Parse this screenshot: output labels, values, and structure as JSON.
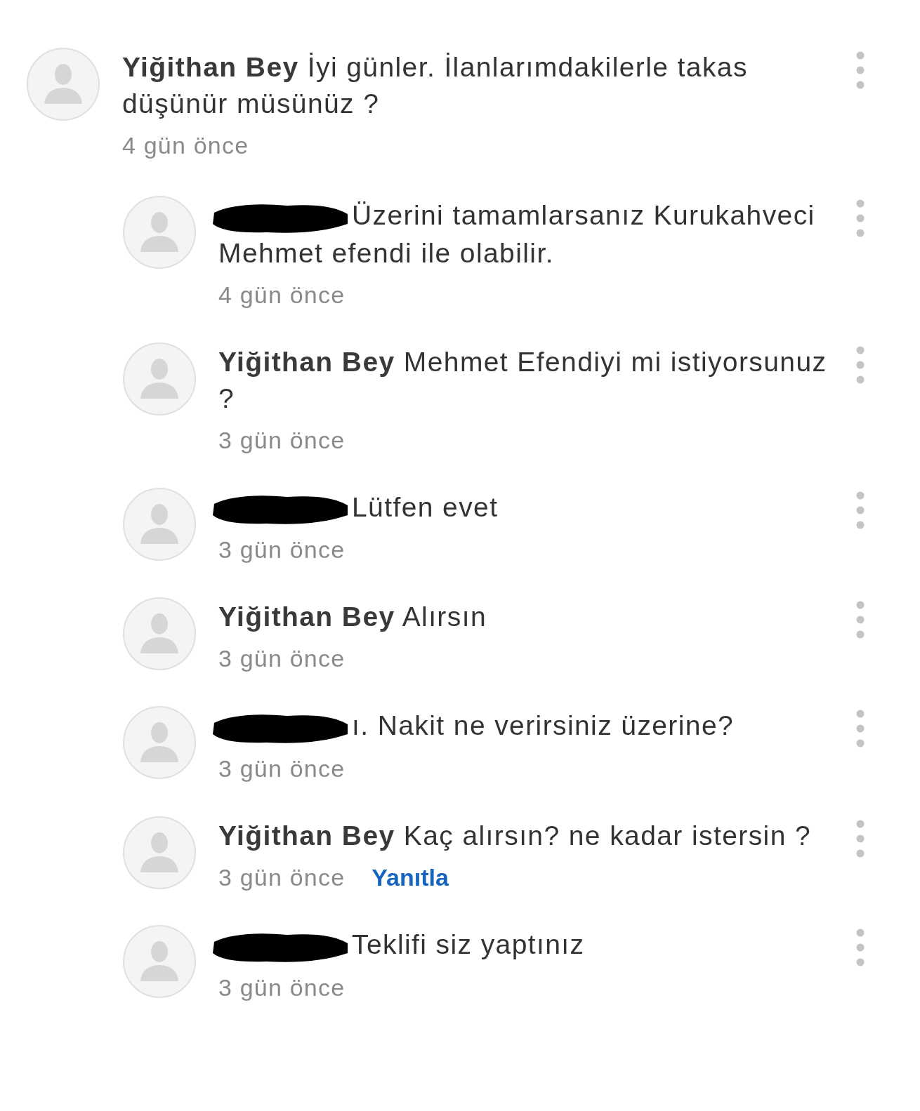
{
  "comments": [
    {
      "author": "Yiğithan Bey",
      "text": "İyi günler. İlanlarımdakilerle takas düşünür müsünüz ?",
      "time": "4 gün önce",
      "children": [
        {
          "redacted": true,
          "text": "Üzerini tamamlarsanız Kurukahveci Mehmet efendi ile olabilir.",
          "time": "4 gün önce"
        },
        {
          "author": "Yiğithan Bey",
          "text": "Mehmet Efendiyi mi istiyorsunuz ?",
          "time": "3 gün önce"
        },
        {
          "redacted": true,
          "text": "Lütfen evet",
          "time": "3 gün önce"
        },
        {
          "author": "Yiğithan Bey",
          "text": "Alırsın",
          "time": "3 gün önce"
        },
        {
          "redacted": true,
          "text": "ı. Nakit ne verirsiniz üzerine?",
          "time": "3 gün önce"
        },
        {
          "author": "Yiğithan Bey",
          "text": "Kaç alırsın? ne kadar istersin ?",
          "time": "3 gün önce",
          "reply_link": "Yanıtla"
        },
        {
          "redacted": true,
          "text": "Teklifi siz yaptınız",
          "time": "3 gün önce"
        }
      ]
    }
  ]
}
